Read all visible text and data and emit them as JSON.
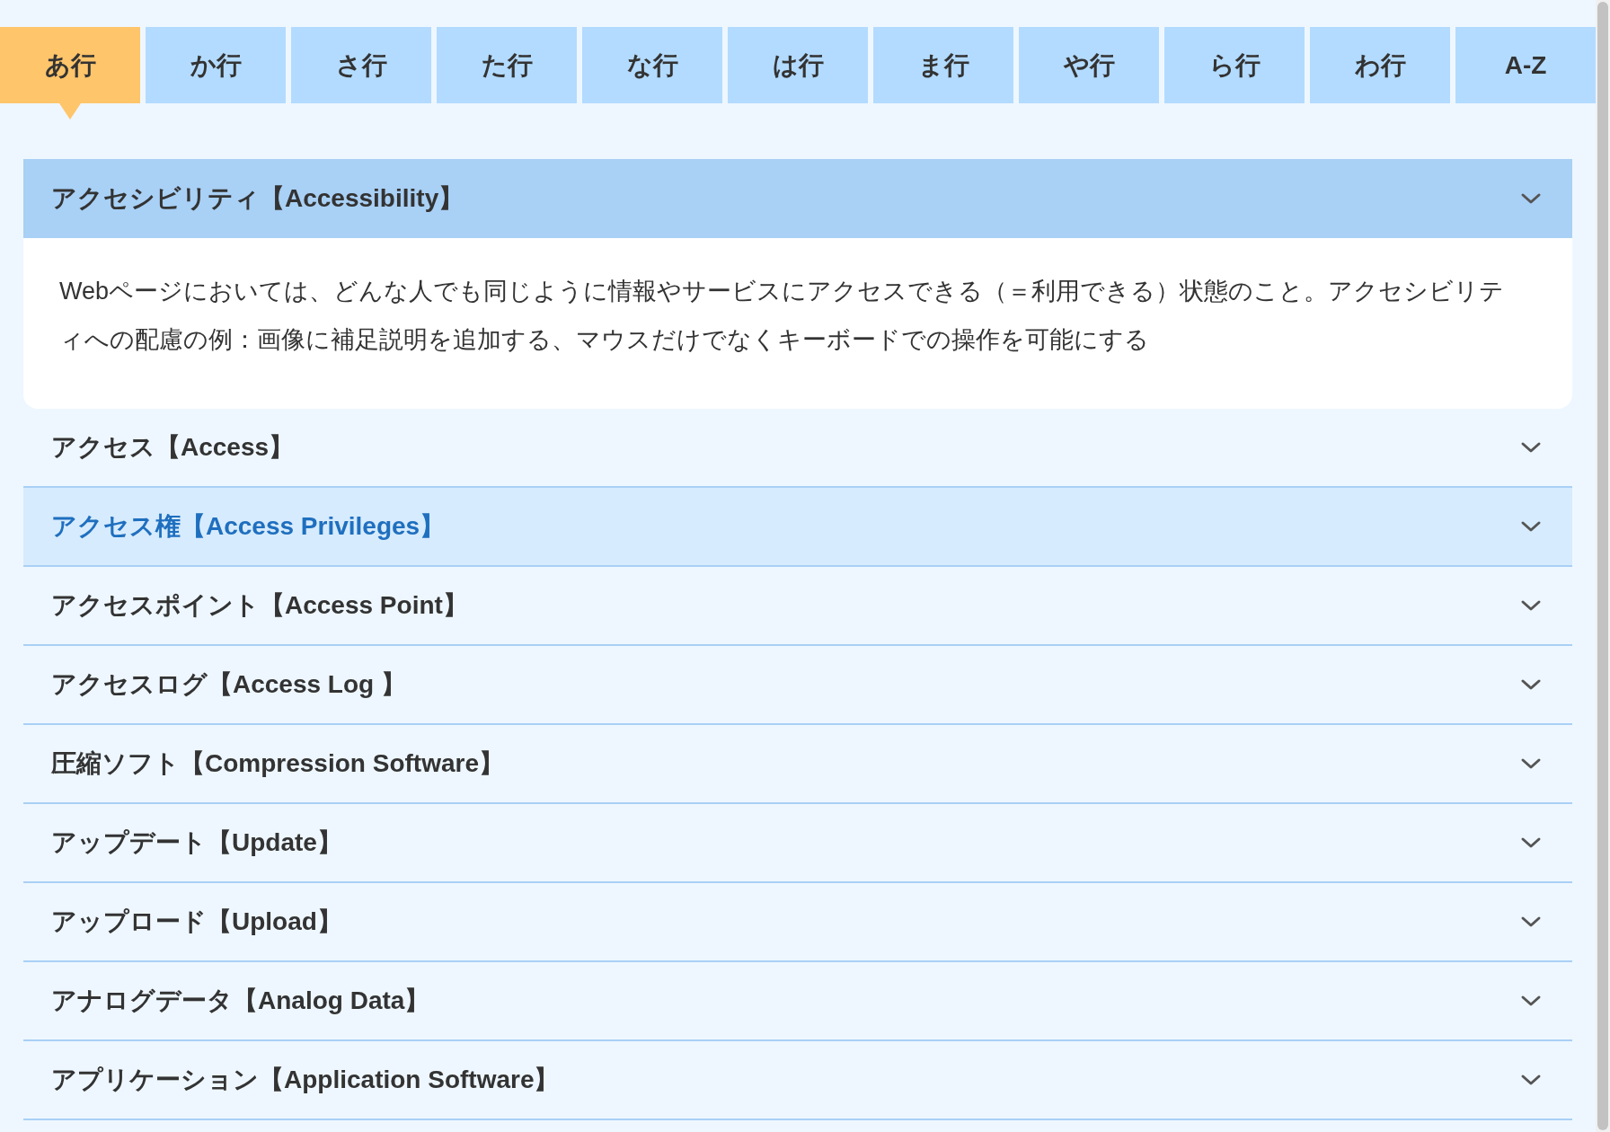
{
  "tabs": [
    {
      "label": "あ行",
      "selected": true
    },
    {
      "label": "か行",
      "selected": false
    },
    {
      "label": "さ行",
      "selected": false
    },
    {
      "label": "た行",
      "selected": false
    },
    {
      "label": "な行",
      "selected": false
    },
    {
      "label": "は行",
      "selected": false
    },
    {
      "label": "ま行",
      "selected": false
    },
    {
      "label": "や行",
      "selected": false
    },
    {
      "label": "ら行",
      "selected": false
    },
    {
      "label": "わ行",
      "selected": false
    },
    {
      "label": "A-Z",
      "selected": false
    }
  ],
  "glossary": [
    {
      "term": "アクセシビリティ【Accessibility】",
      "expanded": true,
      "highlighted": false,
      "definition": "Webページにおいては、どんな人でも同じように情報やサービスにアクセスできる（＝利用できる）状態のこと。アクセシビリティへの配慮の例：画像に補足説明を追加する、マウスだけでなくキーボードでの操作を可能にする"
    },
    {
      "term": "アクセス【Access】",
      "expanded": false,
      "highlighted": false
    },
    {
      "term": "アクセス権【Access Privileges】",
      "expanded": false,
      "highlighted": true
    },
    {
      "term": "アクセスポイント【Access Point】",
      "expanded": false,
      "highlighted": false
    },
    {
      "term": "アクセスログ【Access Log 】",
      "expanded": false,
      "highlighted": false
    },
    {
      "term": "圧縮ソフト【Compression Software】",
      "expanded": false,
      "highlighted": false
    },
    {
      "term": "アップデート【Update】",
      "expanded": false,
      "highlighted": false
    },
    {
      "term": "アップロード【Upload】",
      "expanded": false,
      "highlighted": false
    },
    {
      "term": "アナログデータ【Analog Data】",
      "expanded": false,
      "highlighted": false
    },
    {
      "term": "アプリケーション【Application Software】",
      "expanded": false,
      "highlighted": false
    }
  ]
}
